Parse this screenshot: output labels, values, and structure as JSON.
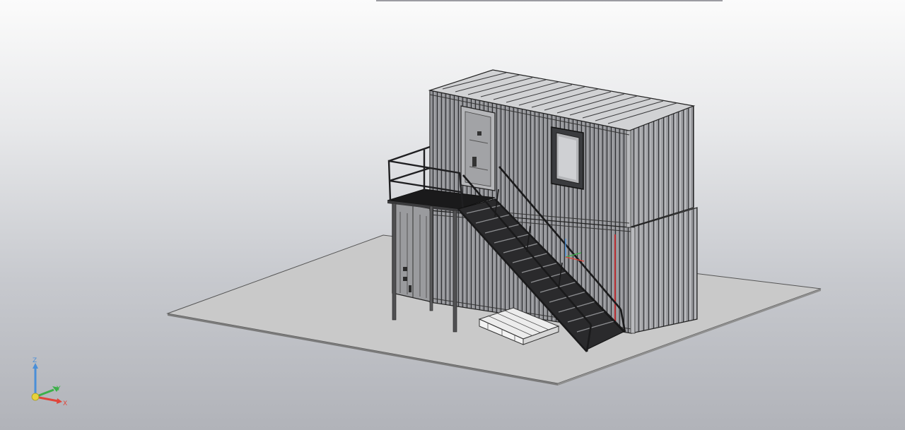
{
  "viewport": {
    "background_top": "#fbfbfb",
    "background_bottom": "#b1b3b9",
    "model_description_icon": "3d-model-containers-icon"
  },
  "triad": {
    "x_label": "X",
    "y_label": "Y",
    "z_label": "Z",
    "x_color": "#e0453a",
    "y_color": "#3db04a",
    "z_color": "#4a8fd8",
    "origin_color": "#e8d23a"
  }
}
